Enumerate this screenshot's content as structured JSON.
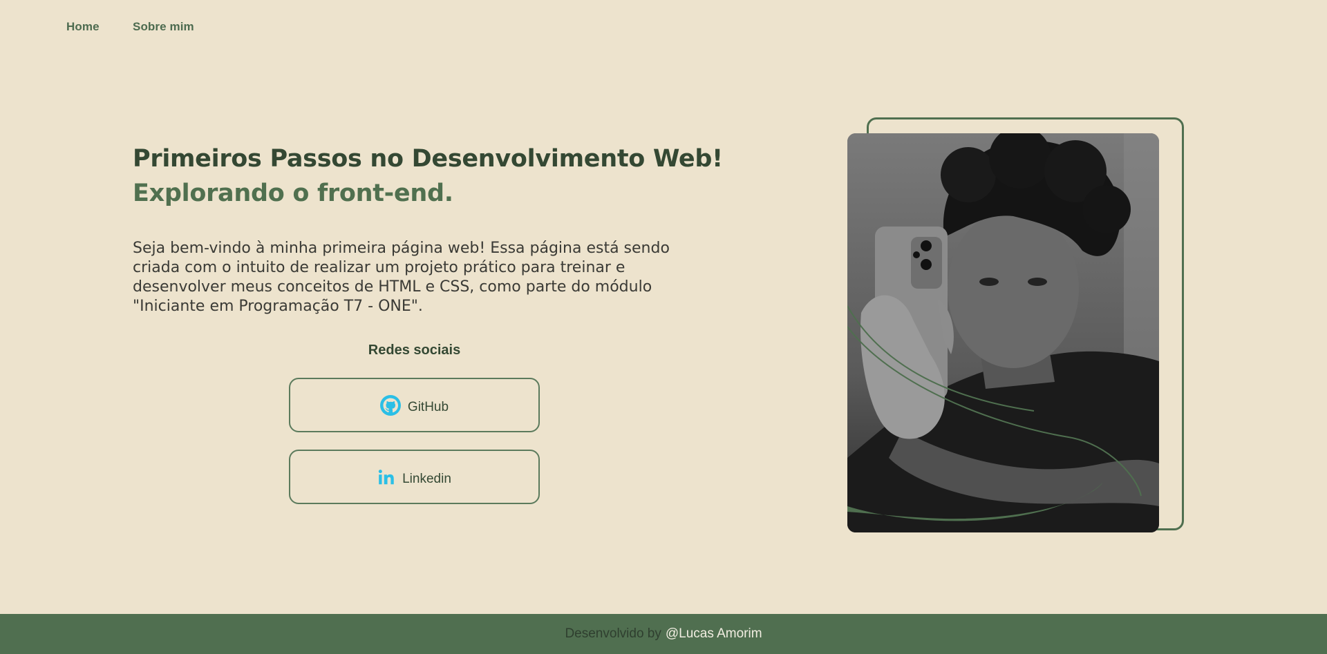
{
  "nav": {
    "items": [
      {
        "label": "Home"
      },
      {
        "label": "Sobre mim"
      }
    ]
  },
  "hero": {
    "title": "Primeiros Passos no Desenvolvimento Web!",
    "subtitle": "Explorando o front-end.",
    "intro": "Seja bem-vindo à minha primeira página web! Essa página está sendo criada com o intuito de realizar um projeto prático para treinar e desenvolver meus conceitos de HTML e CSS, como parte do módulo \"Iniciante em Programação T7 - ONE\"."
  },
  "social": {
    "heading": "Redes sociais",
    "buttons": [
      {
        "label": "GitHub",
        "icon": "github-icon"
      },
      {
        "label": "Linkedin",
        "icon": "linkedin-icon"
      }
    ]
  },
  "portrait": {
    "description_icon": "profile-photo"
  },
  "footer": {
    "prefix": "Desenvolvido by",
    "author": "@Lucas Amorim"
  },
  "colors": {
    "background": "#ede3cd",
    "primary_dark": "#344833",
    "primary": "#50704f",
    "footer_bg": "#506f50",
    "icon_accent": "#2bbfe6"
  }
}
